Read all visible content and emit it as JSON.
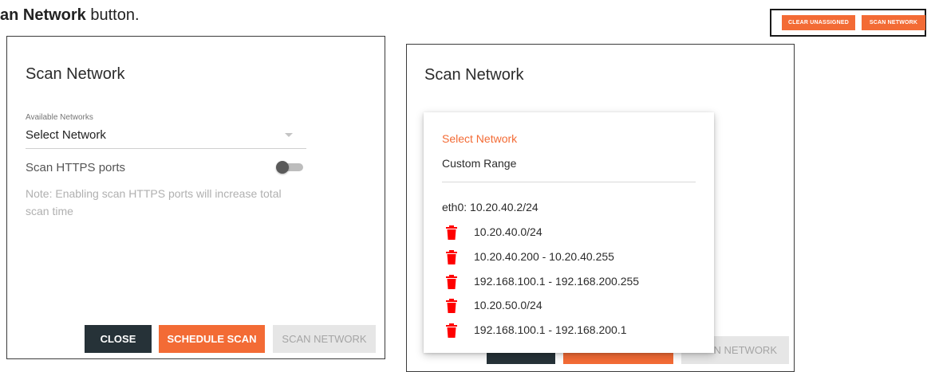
{
  "instruction": {
    "bold_text": "an Network",
    "rest_text": " button."
  },
  "toolbar": {
    "clear_unassigned_label": "CLEAR UNASSIGNED",
    "scan_network_label": "SCAN NETWORK"
  },
  "dialog_left": {
    "title": "Scan Network",
    "field_label": "Available Networks",
    "field_value": "Select Network",
    "toggle_label": "Scan HTTPS ports",
    "toggle_on": false,
    "note_line1": "Note: Enabling scan HTTPS ports will increase total",
    "note_line2": "scan time",
    "close_label": "CLOSE",
    "schedule_label": "SCHEDULE SCAN",
    "scan_label": "SCAN NETWORK"
  },
  "dialog_right": {
    "title": "Scan Network",
    "scan_label_partial": "N NETWORK",
    "menu": {
      "header": "Select Network",
      "custom_range": "Custom Range",
      "interface": "eth0: 10.20.40.2/24",
      "ranges": [
        {
          "label": "10.20.40.0/24",
          "icon": "trash-icon"
        },
        {
          "label": "10.20.40.200 - 10.20.40.255",
          "icon": "trash-icon"
        },
        {
          "label": "192.168.100.1 - 192.168.200.255",
          "icon": "trash-icon"
        },
        {
          "label": "10.20.50.0/24",
          "icon": "trash-icon"
        },
        {
          "label": "192.168.100.1 - 192.168.200.1",
          "icon": "trash-icon"
        }
      ]
    }
  },
  "colors": {
    "accent": "#f36b35",
    "danger": "#ff0000",
    "dark_button": "#263238"
  }
}
